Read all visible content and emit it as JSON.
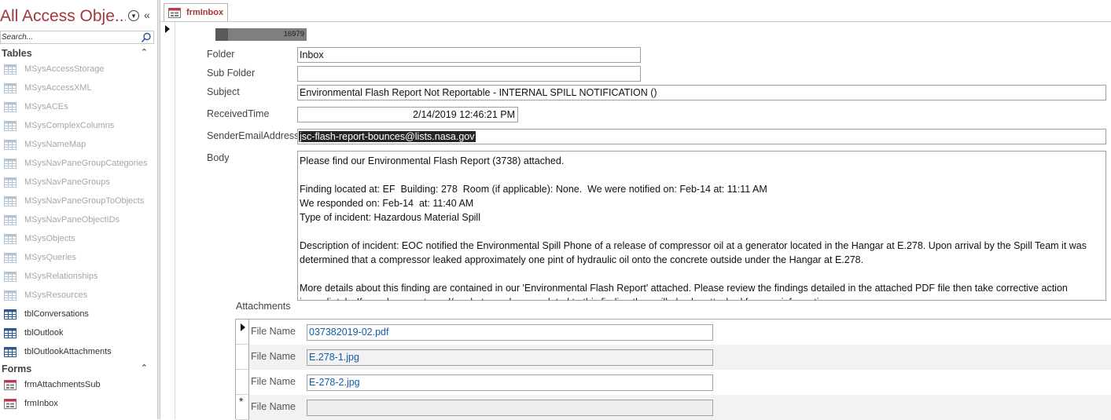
{
  "nav": {
    "title": "All Access Obje...",
    "search_placeholder": "Search...",
    "groups": [
      {
        "label": "Tables",
        "items": [
          {
            "label": "MSysAccessStorage",
            "system": true
          },
          {
            "label": "MSysAccessXML",
            "system": true
          },
          {
            "label": "MSysACEs",
            "system": true
          },
          {
            "label": "MSysComplexColumns",
            "system": true
          },
          {
            "label": "MSysNameMap",
            "system": true
          },
          {
            "label": "MSysNavPaneGroupCategories",
            "system": true
          },
          {
            "label": "MSysNavPaneGroups",
            "system": true
          },
          {
            "label": "MSysNavPaneGroupToObjects",
            "system": true
          },
          {
            "label": "MSysNavPaneObjectIDs",
            "system": true
          },
          {
            "label": "MSysObjects",
            "system": true
          },
          {
            "label": "MSysQueries",
            "system": true
          },
          {
            "label": "MSysRelationships",
            "system": true
          },
          {
            "label": "MSysResources",
            "system": true
          },
          {
            "label": "tblConversations",
            "system": false
          },
          {
            "label": "tblOutlook",
            "system": false
          },
          {
            "label": "tblOutlookAttachments",
            "system": false
          }
        ]
      },
      {
        "label": "Forms",
        "items": [
          {
            "label": "frmAttachmentsSub",
            "system": false
          },
          {
            "label": "frmInbox",
            "system": false
          }
        ]
      }
    ]
  },
  "tab": {
    "label": "frmInbox"
  },
  "form": {
    "id_value": "16979",
    "fields": {
      "folder": {
        "label": "Folder",
        "value": "Inbox"
      },
      "subfolder": {
        "label": "Sub Folder",
        "value": ""
      },
      "subject": {
        "label": "Subject",
        "value": "Environmental Flash Report Not Reportable - INTERNAL SPILL NOTIFICATION ()"
      },
      "received": {
        "label": "ReceivedTime",
        "value": "2/14/2019 12:46:21 PM"
      },
      "sender": {
        "label": "SenderEmailAddress",
        "value": "jsc-flash-report-bounces@lists.nasa.gov"
      },
      "body": {
        "label": "Body",
        "paragraphs": [
          "Please find our Environmental Flash Report (3738) attached.",
          "",
          "Finding located at: EF  Building: 278  Room (if applicable): None.  We were notified on: Feb-14 at: 11:11 AM",
          "We responded on: Feb-14  at: 11:40 AM",
          "Type of incident: Hazardous Material Spill",
          "",
          "Description of incident: EOC notified the Environmental Spill Phone of a release of compressor oil at a generator located in the Hangar at E.278. Upon arrival by the Spill Team it was determined that a compressor leaked approximately one pint of hydraulic oil onto the concrete outside under the Hangar at E.278.",
          "",
          "More details about this finding are contained in our 'Environmental Flash Report' attached. Please review the findings detailed in the attached PDF file then take corrective action immediately. If any documents and/or photographs are related to this finding they will also be attached for your information."
        ]
      }
    },
    "attachments": {
      "label": "Attachments",
      "field_label": "File Name",
      "rows": [
        {
          "file": "037382019-02.pdf"
        },
        {
          "file": "E.278-1.jpg"
        },
        {
          "file": "E-278-2.jpg"
        },
        {
          "file": ""
        }
      ]
    }
  },
  "colors": {
    "accent": "#a4373a",
    "link": "#0f5ea8"
  }
}
